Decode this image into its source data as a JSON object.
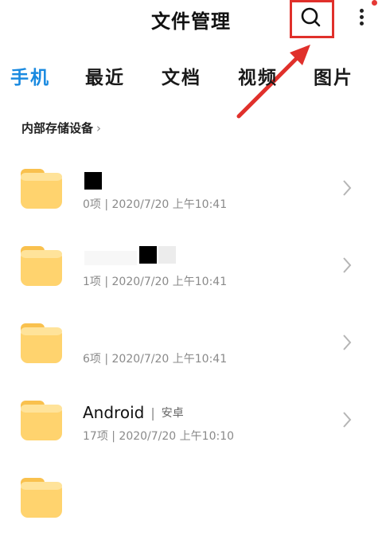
{
  "header": {
    "title": "文件管理"
  },
  "tabs": [
    {
      "label": "手机",
      "active": true
    },
    {
      "label": "最近",
      "active": false
    },
    {
      "label": "文档",
      "active": false
    },
    {
      "label": "视频",
      "active": false
    },
    {
      "label": "图片",
      "active": false
    }
  ],
  "breadcrumb": {
    "label": "内部存储设备",
    "chevron": "›"
  },
  "folders": [
    {
      "name": "",
      "alias": "",
      "meta": "0项 | 2020/7/20 上午10:41"
    },
    {
      "name": "",
      "alias": "",
      "meta": "1项 | 2020/7/20 上午10:41"
    },
    {
      "name": "",
      "alias": "",
      "meta": "6项 | 2020/7/20 上午10:41"
    },
    {
      "name": "Android",
      "alias": "安卓",
      "meta": "17项 | 2020/7/20 上午10:10"
    }
  ],
  "colors": {
    "accent": "#1a8ae0",
    "folder": "#ffd36e",
    "annotation": "#e0302b"
  },
  "icons": {
    "search": "search-icon",
    "more": "more-vertical-icon",
    "folder": "folder-icon",
    "chevron": "chevron-right-icon"
  }
}
